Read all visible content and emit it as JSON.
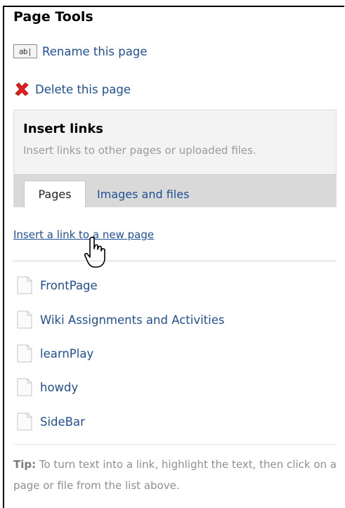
{
  "panel": {
    "title": "Page Tools"
  },
  "actions": {
    "rename": {
      "label": "Rename this page",
      "icon": "rename-text-icon",
      "icon_text": "ab|"
    },
    "delete": {
      "label": "Delete this page",
      "icon": "red-x-delete-icon"
    }
  },
  "insert_links": {
    "title": "Insert links",
    "description": "Insert links to other pages or uploaded files.",
    "tabs": [
      {
        "label": "Pages",
        "active": true
      },
      {
        "label": "Images and files",
        "active": false
      }
    ]
  },
  "new_page_link": "Insert a link to a new page",
  "pages": [
    {
      "name": "FrontPage",
      "icon": "document-icon"
    },
    {
      "name": "Wiki Assignments and Activities",
      "icon": "document-icon"
    },
    {
      "name": "learnPlay",
      "icon": "document-icon"
    },
    {
      "name": "howdy",
      "icon": "document-icon"
    },
    {
      "name": "SideBar",
      "icon": "document-icon"
    }
  ],
  "tip": {
    "label": "Tip:",
    "text": " To turn text into a link, highlight the text, then click on a page or file from the list above."
  },
  "colors": {
    "link": "#1f4f93",
    "panel_bg": "#f3f3f3",
    "tabbar_bg": "#d9d9d9",
    "delete_red": "#e02020"
  }
}
